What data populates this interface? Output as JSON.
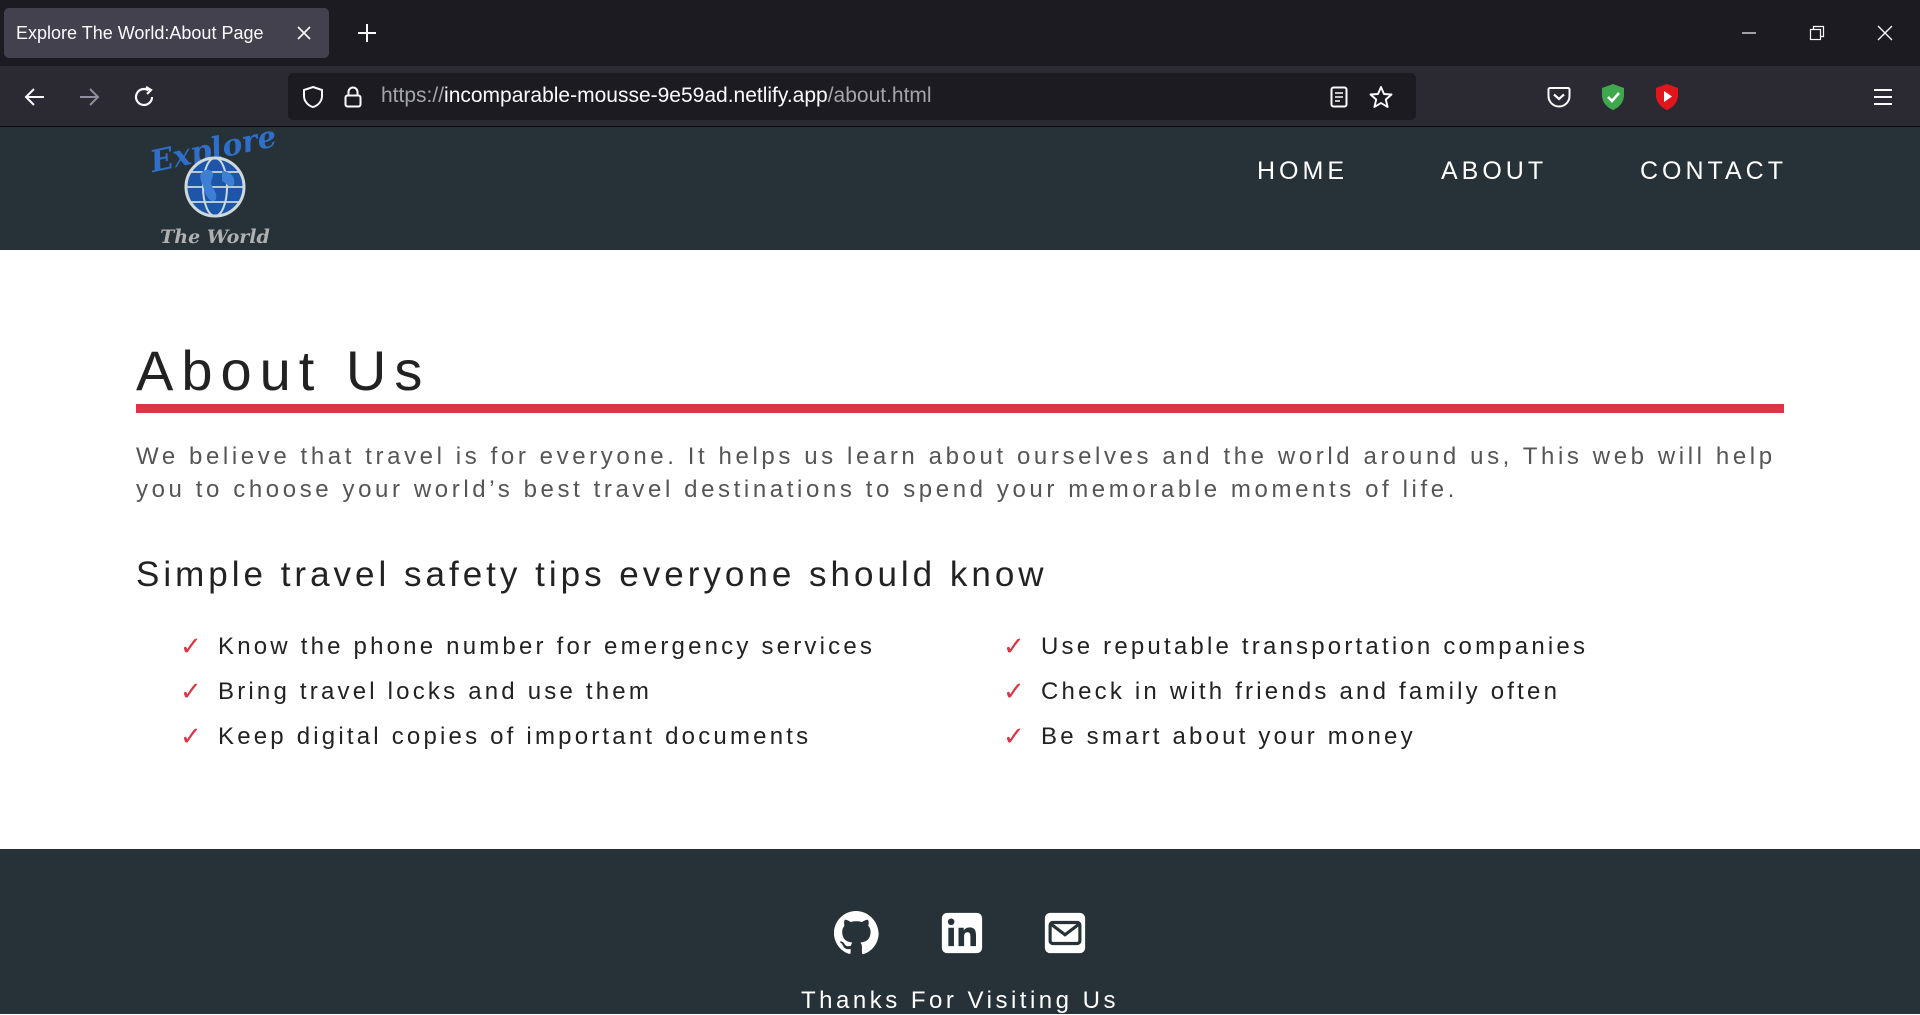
{
  "browser": {
    "tab_title": "Explore The World:About Page",
    "url_scheme": "https://",
    "url_host": "incomparable-mousse-9e59ad.netlify.app",
    "url_path": "/about.html"
  },
  "site": {
    "logo_text_top": "Explore",
    "logo_text_bottom": "The World",
    "nav": [
      "HOME",
      "ABOUT",
      "CONTACT"
    ]
  },
  "main": {
    "title": "About Us",
    "paragraph": "We believe that travel is for everyone. It helps us learn about ourselves and the world around us, This web will help you to choose your world’s best travel destinations to spend your memorable moments of life.",
    "tips_title": "Simple travel safety tips everyone should know",
    "tips_left": [
      "Know the phone number for emergency services",
      "Bring travel locks and use them",
      "Keep digital copies of important documents"
    ],
    "tips_right": [
      "Use reputable transportation companies",
      "Check in with friends and family often",
      "Be smart about your money"
    ],
    "check_glyph": "✓"
  },
  "footer": {
    "icons": [
      "github-icon",
      "linkedin-icon",
      "mail-icon"
    ],
    "thanks": "Thanks For Visiting Us"
  },
  "colors": {
    "header_bg": "#263238",
    "accent_red": "#dc3545",
    "browser_bg": "#1c1b22"
  }
}
